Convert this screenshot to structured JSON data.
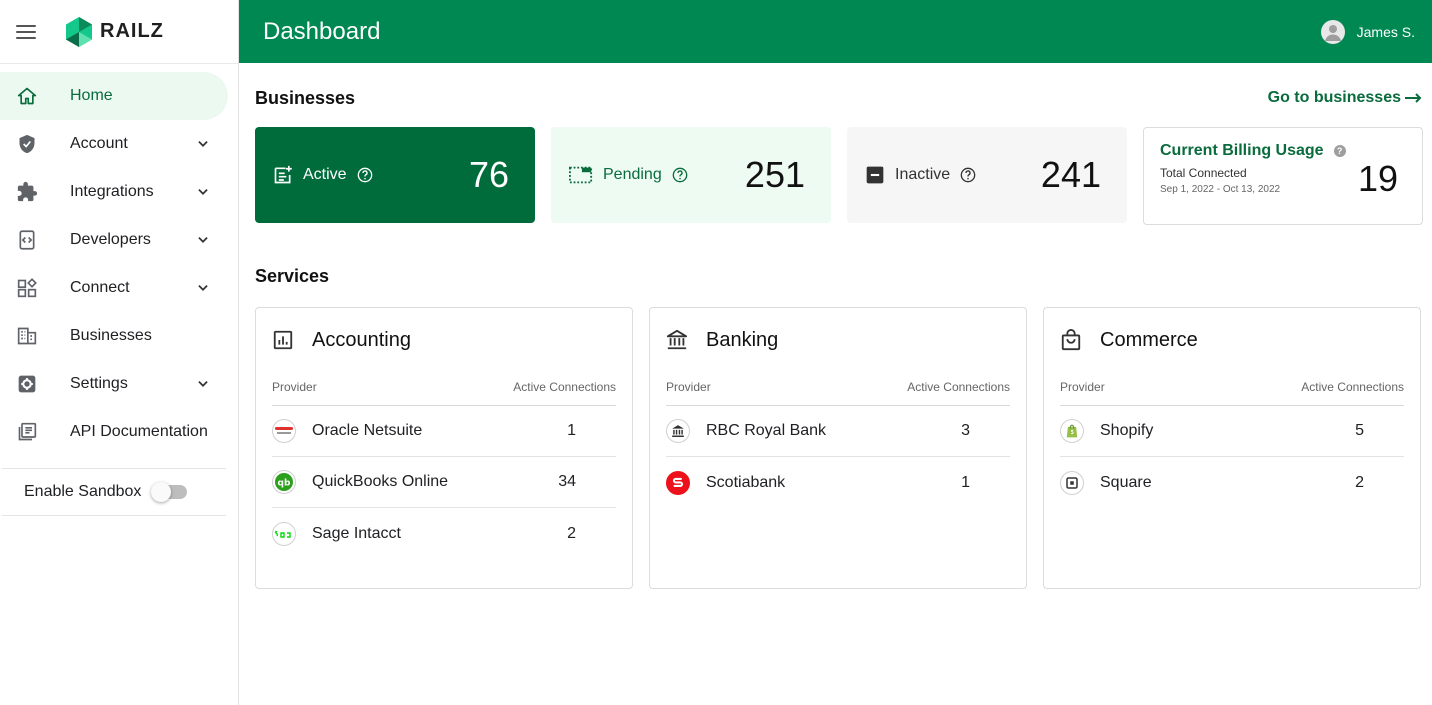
{
  "sidebar": {
    "brand": "RAILZ",
    "items": [
      {
        "label": "Home",
        "icon": "home-icon",
        "expandable": false,
        "active": true
      },
      {
        "label": "Account",
        "icon": "shield-icon",
        "expandable": true
      },
      {
        "label": "Integrations",
        "icon": "puzzle-icon",
        "expandable": true
      },
      {
        "label": "Developers",
        "icon": "code-icon",
        "expandable": true
      },
      {
        "label": "Connect",
        "icon": "widgets-icon",
        "expandable": true
      },
      {
        "label": "Businesses",
        "icon": "building-icon",
        "expandable": false
      },
      {
        "label": "Settings",
        "icon": "gear-icon",
        "expandable": true
      },
      {
        "label": "API Documentation",
        "icon": "docs-icon",
        "expandable": false
      }
    ],
    "sandbox_label": "Enable Sandbox",
    "sandbox_enabled": false
  },
  "header": {
    "title": "Dashboard",
    "user_name": "James S."
  },
  "businesses": {
    "title": "Businesses",
    "go_link": "Go to businesses",
    "stats": [
      {
        "label": "Active",
        "value": "76"
      },
      {
        "label": "Pending",
        "value": "251"
      },
      {
        "label": "Inactive",
        "value": "241"
      }
    ],
    "billing": {
      "title": "Current Billing Usage",
      "subtitle": "Total Connected",
      "range": "Sep 1, 2022 - Oct 13, 2022",
      "value": "19"
    }
  },
  "services": {
    "title": "Services",
    "col_provider": "Provider",
    "col_connections": "Active Connections",
    "cards": [
      {
        "name": "Accounting",
        "icon": "chart-icon",
        "rows": [
          {
            "provider": "Oracle Netsuite",
            "count": "1",
            "logo": "oracle-netsuite-logo"
          },
          {
            "provider": "QuickBooks Online",
            "count": "34",
            "logo": "quickbooks-logo"
          },
          {
            "provider": "Sage Intacct",
            "count": "2",
            "logo": "sage-logo"
          }
        ]
      },
      {
        "name": "Banking",
        "icon": "bank-icon",
        "rows": [
          {
            "provider": "RBC Royal Bank",
            "count": "3",
            "logo": "bank-logo"
          },
          {
            "provider": "Scotiabank",
            "count": "1",
            "logo": "scotiabank-logo"
          }
        ]
      },
      {
        "name": "Commerce",
        "icon": "shopping-bag-icon",
        "rows": [
          {
            "provider": "Shopify",
            "count": "5",
            "logo": "shopify-logo"
          },
          {
            "provider": "Square",
            "count": "2",
            "logo": "square-logo"
          }
        ]
      }
    ]
  },
  "colors": {
    "brand_green": "#008853",
    "dark_green": "#006b3b",
    "light_green": "#edfbf3",
    "link_green": "#0a6b3d"
  }
}
